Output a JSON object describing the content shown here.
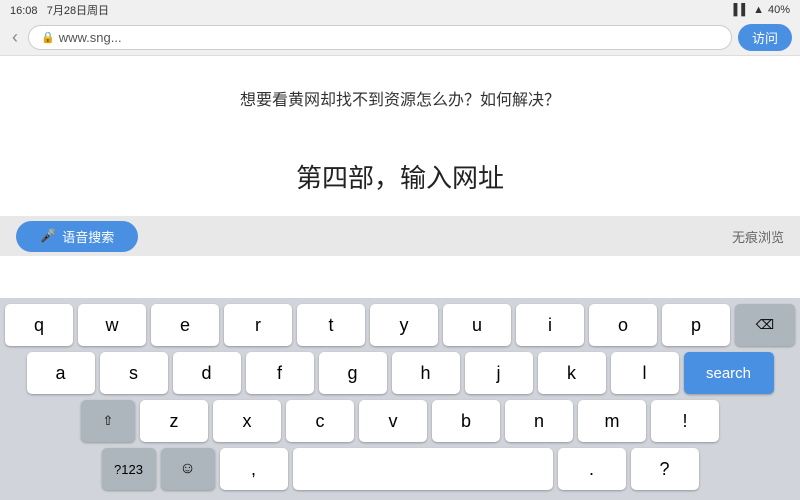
{
  "statusBar": {
    "time": "16:08",
    "date": "7月28日周日",
    "signal": "▌▌",
    "battery": "40%"
  },
  "browser": {
    "addressPlaceholder": "www.sng...",
    "visitLabel": "访问",
    "backIcon": "‹"
  },
  "content": {
    "questionTitle": "想要看黄网却找不到资源怎么办？如何解决？",
    "partLabel": "第四部，输入网址"
  },
  "voiceBar": {
    "voiceSearchLabel": "语音搜索",
    "privateLabel": "无痕浏览",
    "micIcon": "🎤"
  },
  "keyboard": {
    "row1": [
      "q",
      "w",
      "e",
      "r",
      "t",
      "y",
      "u",
      "i",
      "o",
      "p"
    ],
    "row2": [
      "a",
      "s",
      "d",
      "f",
      "g",
      "h",
      "j",
      "k",
      "l"
    ],
    "row3": [
      "z",
      "x",
      "c",
      "v",
      "b",
      "n",
      "m"
    ],
    "searchLabel": "search",
    "backspaceIcon": "⌫",
    "shiftIcon": "⇧",
    "symbolsLabel": "?123",
    "emojiLabel": "☺",
    "spaceLabel": "",
    "periodLabel": ".",
    "commaLabel": ","
  }
}
